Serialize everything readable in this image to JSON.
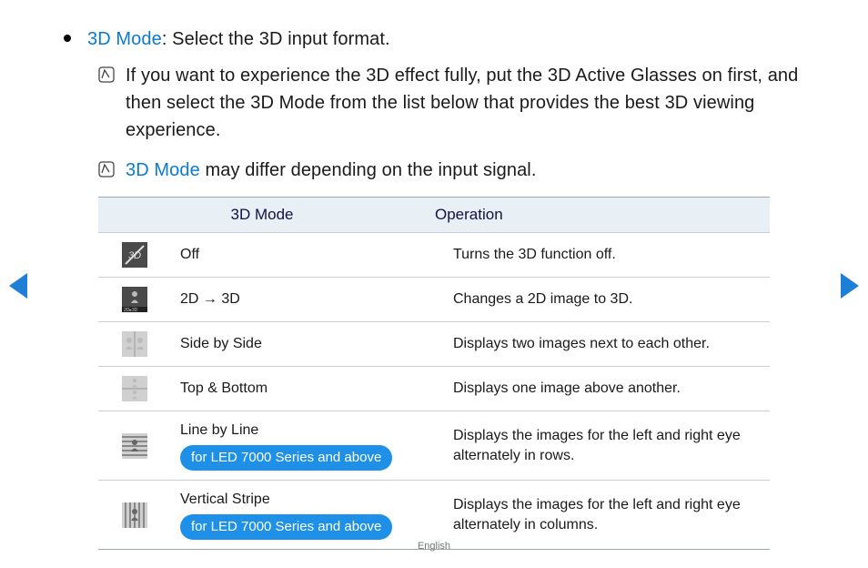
{
  "intro": {
    "term": "3D Mode",
    "desc": ": Select the 3D input format."
  },
  "notes": [
    {
      "text": "If you want to experience the 3D effect fully, put the 3D Active Glasses on first, and then select the 3D Mode from the list below that provides the best 3D viewing experience."
    },
    {
      "term": "3D Mode",
      "text": " may differ depending on the input signal."
    }
  ],
  "table": {
    "headers": {
      "mode": "3D Mode",
      "op": "Operation"
    },
    "rows": [
      {
        "icon": "off",
        "mode": "Off",
        "badge": null,
        "op": "Turns the 3D function off."
      },
      {
        "icon": "2d3d",
        "mode": "2D → 3D",
        "badge": null,
        "op": "Changes a 2D image to 3D."
      },
      {
        "icon": "sbs",
        "mode": "Side by Side",
        "badge": null,
        "op": "Displays two images next to each other."
      },
      {
        "icon": "tb",
        "mode": "Top & Bottom",
        "badge": null,
        "op": "Displays one image above another."
      },
      {
        "icon": "lbl",
        "mode": "Line by Line",
        "badge": "for LED 7000 Series and above",
        "op": "Displays the images for the left and right eye alternately in rows."
      },
      {
        "icon": "vs",
        "mode": "Vertical Stripe",
        "badge": "for LED 7000 Series and above",
        "op": "Displays the images for the left and right eye alternately in columns."
      }
    ]
  },
  "footer": "English",
  "icons": {
    "off": "svg-off",
    "2d3d": "svg-2d3d",
    "sbs": "svg-sbs",
    "tb": "svg-tb",
    "lbl": "svg-lbl",
    "vs": "svg-vs"
  }
}
